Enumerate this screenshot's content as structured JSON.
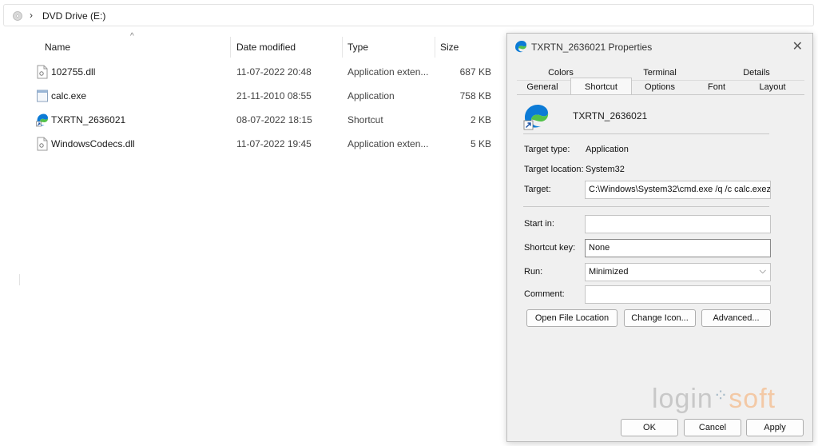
{
  "address_bar": {
    "crumb": "DVD Drive (E:)"
  },
  "columns": {
    "name": "Name",
    "date": "Date modified",
    "type": "Type",
    "size": "Size"
  },
  "files": [
    {
      "name": "102755.dll",
      "date": "11-07-2022 20:48",
      "type": "Application exten...",
      "size": "687 KB",
      "icon": "dll-file-icon"
    },
    {
      "name": "calc.exe",
      "date": "21-11-2010 08:55",
      "type": "Application",
      "size": "758 KB",
      "icon": "exe-file-icon"
    },
    {
      "name": "TXRTN_2636021",
      "date": "08-07-2022 18:15",
      "type": "Shortcut",
      "size": "2 KB",
      "icon": "edge-shortcut-icon"
    },
    {
      "name": "WindowsCodecs.dll",
      "date": "11-07-2022 19:45",
      "type": "Application exten...",
      "size": "5 KB",
      "icon": "dll-file-icon"
    }
  ],
  "dialog": {
    "title": "TXRTN_2636021 Properties",
    "close": "✕",
    "tabs_row1": [
      "Colors",
      "Terminal",
      "Details"
    ],
    "tabs_row2": [
      "General",
      "Shortcut",
      "Options",
      "Font",
      "Layout"
    ],
    "active_tab": "Shortcut",
    "shortcut_name": "TXRTN_2636021",
    "target_type_label": "Target type:",
    "target_type_value": "Application",
    "target_location_label": "Target location:",
    "target_location_value": "System32",
    "target_label": "Target:",
    "target_value": "C:\\Windows\\System32\\cmd.exe /q /c calc.exez",
    "start_in_label": "Start in:",
    "start_in_value": "",
    "shortcut_key_label": "Shortcut key:",
    "shortcut_key_value": "None",
    "run_label": "Run:",
    "run_value": "Minimized",
    "comment_label": "Comment:",
    "comment_value": "",
    "buttons": {
      "open_file_location": "Open File Location",
      "change_icon": "Change Icon...",
      "advanced": "Advanced..."
    },
    "footer": {
      "ok": "OK",
      "cancel": "Cancel",
      "apply": "Apply"
    },
    "watermark": {
      "part1": "login",
      "part2": "soft"
    }
  },
  "colors": {
    "edge_blue": "#0c7bd6",
    "edge_green": "#53c24a",
    "accent_border": "#adadad"
  }
}
